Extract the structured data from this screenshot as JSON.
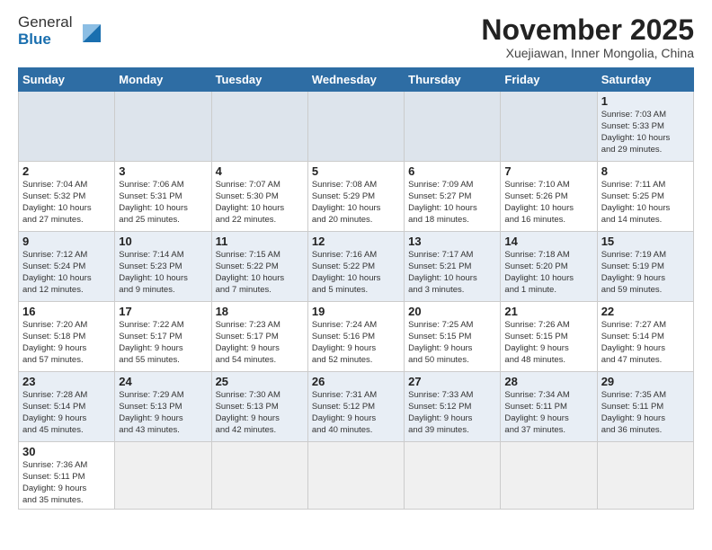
{
  "header": {
    "logo_general": "General",
    "logo_blue": "Blue",
    "month_title": "November 2025",
    "subtitle": "Xuejiawan, Inner Mongolia, China"
  },
  "weekdays": [
    "Sunday",
    "Monday",
    "Tuesday",
    "Wednesday",
    "Thursday",
    "Friday",
    "Saturday"
  ],
  "weeks": [
    [
      {
        "day": "",
        "info": ""
      },
      {
        "day": "",
        "info": ""
      },
      {
        "day": "",
        "info": ""
      },
      {
        "day": "",
        "info": ""
      },
      {
        "day": "",
        "info": ""
      },
      {
        "day": "",
        "info": ""
      },
      {
        "day": "1",
        "info": "Sunrise: 7:03 AM\nSunset: 5:33 PM\nDaylight: 10 hours\nand 29 minutes."
      }
    ],
    [
      {
        "day": "2",
        "info": "Sunrise: 7:04 AM\nSunset: 5:32 PM\nDaylight: 10 hours\nand 27 minutes."
      },
      {
        "day": "3",
        "info": "Sunrise: 7:06 AM\nSunset: 5:31 PM\nDaylight: 10 hours\nand 25 minutes."
      },
      {
        "day": "4",
        "info": "Sunrise: 7:07 AM\nSunset: 5:30 PM\nDaylight: 10 hours\nand 22 minutes."
      },
      {
        "day": "5",
        "info": "Sunrise: 7:08 AM\nSunset: 5:29 PM\nDaylight: 10 hours\nand 20 minutes."
      },
      {
        "day": "6",
        "info": "Sunrise: 7:09 AM\nSunset: 5:27 PM\nDaylight: 10 hours\nand 18 minutes."
      },
      {
        "day": "7",
        "info": "Sunrise: 7:10 AM\nSunset: 5:26 PM\nDaylight: 10 hours\nand 16 minutes."
      },
      {
        "day": "8",
        "info": "Sunrise: 7:11 AM\nSunset: 5:25 PM\nDaylight: 10 hours\nand 14 minutes."
      }
    ],
    [
      {
        "day": "9",
        "info": "Sunrise: 7:12 AM\nSunset: 5:24 PM\nDaylight: 10 hours\nand 12 minutes."
      },
      {
        "day": "10",
        "info": "Sunrise: 7:14 AM\nSunset: 5:23 PM\nDaylight: 10 hours\nand 9 minutes."
      },
      {
        "day": "11",
        "info": "Sunrise: 7:15 AM\nSunset: 5:22 PM\nDaylight: 10 hours\nand 7 minutes."
      },
      {
        "day": "12",
        "info": "Sunrise: 7:16 AM\nSunset: 5:22 PM\nDaylight: 10 hours\nand 5 minutes."
      },
      {
        "day": "13",
        "info": "Sunrise: 7:17 AM\nSunset: 5:21 PM\nDaylight: 10 hours\nand 3 minutes."
      },
      {
        "day": "14",
        "info": "Sunrise: 7:18 AM\nSunset: 5:20 PM\nDaylight: 10 hours\nand 1 minute."
      },
      {
        "day": "15",
        "info": "Sunrise: 7:19 AM\nSunset: 5:19 PM\nDaylight: 9 hours\nand 59 minutes."
      }
    ],
    [
      {
        "day": "16",
        "info": "Sunrise: 7:20 AM\nSunset: 5:18 PM\nDaylight: 9 hours\nand 57 minutes."
      },
      {
        "day": "17",
        "info": "Sunrise: 7:22 AM\nSunset: 5:17 PM\nDaylight: 9 hours\nand 55 minutes."
      },
      {
        "day": "18",
        "info": "Sunrise: 7:23 AM\nSunset: 5:17 PM\nDaylight: 9 hours\nand 54 minutes."
      },
      {
        "day": "19",
        "info": "Sunrise: 7:24 AM\nSunset: 5:16 PM\nDaylight: 9 hours\nand 52 minutes."
      },
      {
        "day": "20",
        "info": "Sunrise: 7:25 AM\nSunset: 5:15 PM\nDaylight: 9 hours\nand 50 minutes."
      },
      {
        "day": "21",
        "info": "Sunrise: 7:26 AM\nSunset: 5:15 PM\nDaylight: 9 hours\nand 48 minutes."
      },
      {
        "day": "22",
        "info": "Sunrise: 7:27 AM\nSunset: 5:14 PM\nDaylight: 9 hours\nand 47 minutes."
      }
    ],
    [
      {
        "day": "23",
        "info": "Sunrise: 7:28 AM\nSunset: 5:14 PM\nDaylight: 9 hours\nand 45 minutes."
      },
      {
        "day": "24",
        "info": "Sunrise: 7:29 AM\nSunset: 5:13 PM\nDaylight: 9 hours\nand 43 minutes."
      },
      {
        "day": "25",
        "info": "Sunrise: 7:30 AM\nSunset: 5:13 PM\nDaylight: 9 hours\nand 42 minutes."
      },
      {
        "day": "26",
        "info": "Sunrise: 7:31 AM\nSunset: 5:12 PM\nDaylight: 9 hours\nand 40 minutes."
      },
      {
        "day": "27",
        "info": "Sunrise: 7:33 AM\nSunset: 5:12 PM\nDaylight: 9 hours\nand 39 minutes."
      },
      {
        "day": "28",
        "info": "Sunrise: 7:34 AM\nSunset: 5:11 PM\nDaylight: 9 hours\nand 37 minutes."
      },
      {
        "day": "29",
        "info": "Sunrise: 7:35 AM\nSunset: 5:11 PM\nDaylight: 9 hours\nand 36 minutes."
      }
    ],
    [
      {
        "day": "30",
        "info": "Sunrise: 7:36 AM\nSunset: 5:11 PM\nDaylight: 9 hours\nand 35 minutes."
      },
      {
        "day": "",
        "info": ""
      },
      {
        "day": "",
        "info": ""
      },
      {
        "day": "",
        "info": ""
      },
      {
        "day": "",
        "info": ""
      },
      {
        "day": "",
        "info": ""
      },
      {
        "day": "",
        "info": ""
      }
    ]
  ]
}
